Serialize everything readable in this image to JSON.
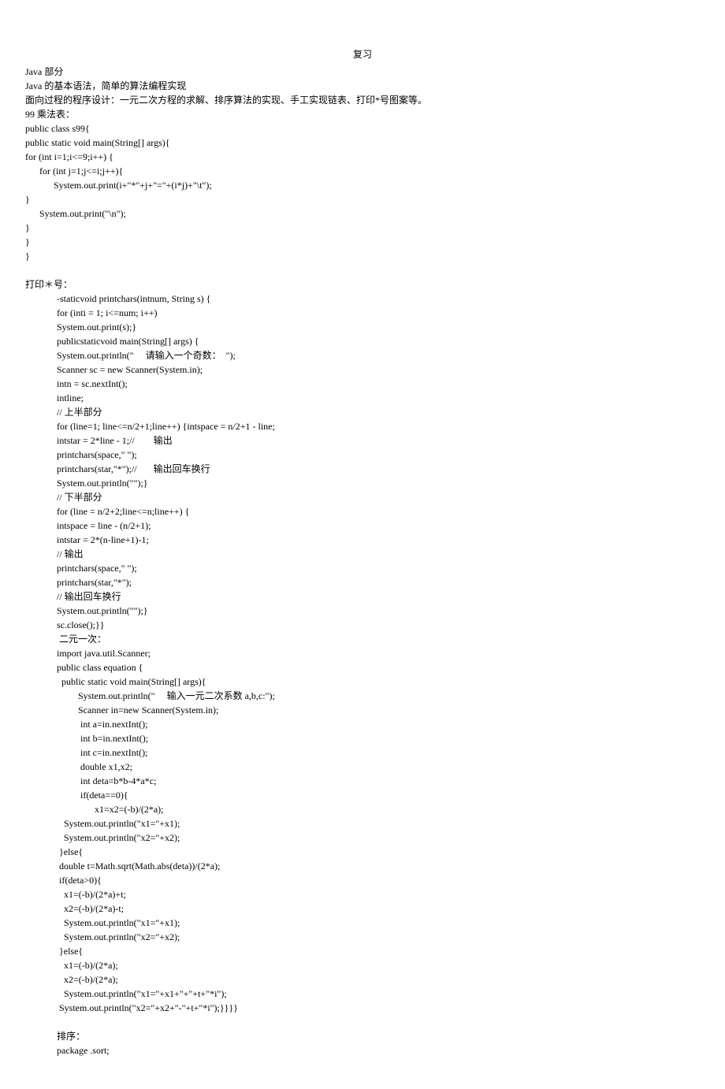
{
  "title": "复习",
  "intro": [
    "Java 部分",
    "Java 的基本语法，简单的算法编程实现",
    "面向过程的程序设计：一元二次方程的求解、排序算法的实现、手工实现链表、打印*号图案等。",
    "99 乘法表："
  ],
  "code99": [
    "public class s99{",
    "public static void main(String[] args){",
    "for (int i=1;i<=9;i++) {",
    "      for (int j=1;j<=i;j++){",
    "            System.out.print(i+\"*\"+j+\"=\"+(i*j)+\"\\t\");",
    "}",
    "      System.out.print(\"\\n\");",
    "}",
    "}",
    "}"
  ],
  "printstar_title": "打印＊号：",
  "printstar": [
    "-staticvoid printchars(intnum, String s) {",
    "for (inti = 1; i<=num; i++)",
    "System.out.print(s);}",
    "publicstaticvoid main(String[] args) {",
    "System.out.println(\"     请输入一个奇数：  \");",
    "Scanner sc = new Scanner(System.in);",
    "intn = sc.nextInt();",
    "intline;",
    "// 上半部分",
    "for (line=1; line<=n/2+1;line++) {intspace = n/2+1 - line;",
    "intstar = 2*line - 1;//        输出",
    "printchars(space,\" \");",
    "printchars(star,\"*\");//       输出回车换行",
    "System.out.println(\"\");}",
    "// 下半部分",
    "for (line = n/2+2;line<=n;line++) {",
    "intspace = line - (n/2+1);",
    "intstar = 2*(n-line+1)-1;",
    "// 输出",
    "printchars(space,\" \");",
    "printchars(star,\"*\");",
    "// 输出回车换行",
    "System.out.println(\"\");}",
    "sc.close();}}"
  ],
  "quad_title": " 二元一次：",
  "quad": [
    "import java.util.Scanner;",
    "",
    "public class equation {",
    "  public static void main(String[] args){",
    "         System.out.println(\"     输入一元二次系数 a,b,c:\");",
    "         Scanner in=new Scanner(System.in);",
    "          int a=in.nextInt();",
    "          int b=in.nextInt();",
    "          int c=in.nextInt();",
    "          double x1,x2;",
    "          int deta=b*b-4*a*c;",
    "          if(deta==0){",
    "                x1=x2=(-b)/(2*a);",
    "   System.out.println(\"x1=\"+x1);",
    "   System.out.println(\"x2=\"+x2);",
    " }else{",
    " double t=Math.sqrt(Math.abs(deta))/(2*a);",
    " if(deta>0){",
    "   x1=(-b)/(2*a)+t;",
    "   x2=(-b)/(2*a)-t;",
    "   System.out.println(\"x1=\"+x1);",
    "   System.out.println(\"x2=\"+x2);",
    " }else{",
    "   x1=(-b)/(2*a);",
    "   x2=(-b)/(2*a);",
    "   System.out.println(\"x1=\"+x1+\"+\"+t+\"*i\");",
    " System.out.println(\"x2=\"+x2+\"-\"+t+\"*i\");}}}}"
  ],
  "sort_title": "排序：",
  "sort_line": "package .sort;"
}
